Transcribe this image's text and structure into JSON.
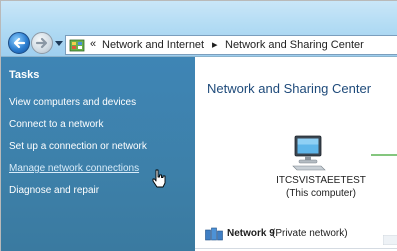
{
  "nav": {
    "breadcrumb_sep_start": "«",
    "crumbs": [
      "Network and Internet",
      "Network and Sharing Center"
    ],
    "separator": "▸"
  },
  "tasks": {
    "heading": "Tasks",
    "links": [
      "View computers and devices",
      "Connect to a network",
      "Set up a connection or network",
      "Manage network connections",
      "Diagnose and repair"
    ],
    "hovered_index": 3
  },
  "main": {
    "title": "Network and Sharing Center",
    "computer_name": "ITCSVISTAEETEST",
    "computer_sub": "(This computer)",
    "network_name": "Network  9",
    "network_type": "(Private network)"
  },
  "colors": {
    "task_pane": "#3d80a9",
    "title_text": "#1e4a7a",
    "connection_line": "#84c67e"
  },
  "icons": [
    "back-arrow-icon",
    "forward-arrow-icon",
    "control-panel-icon",
    "computer-icon",
    "network-icon",
    "hand-cursor-icon"
  ]
}
